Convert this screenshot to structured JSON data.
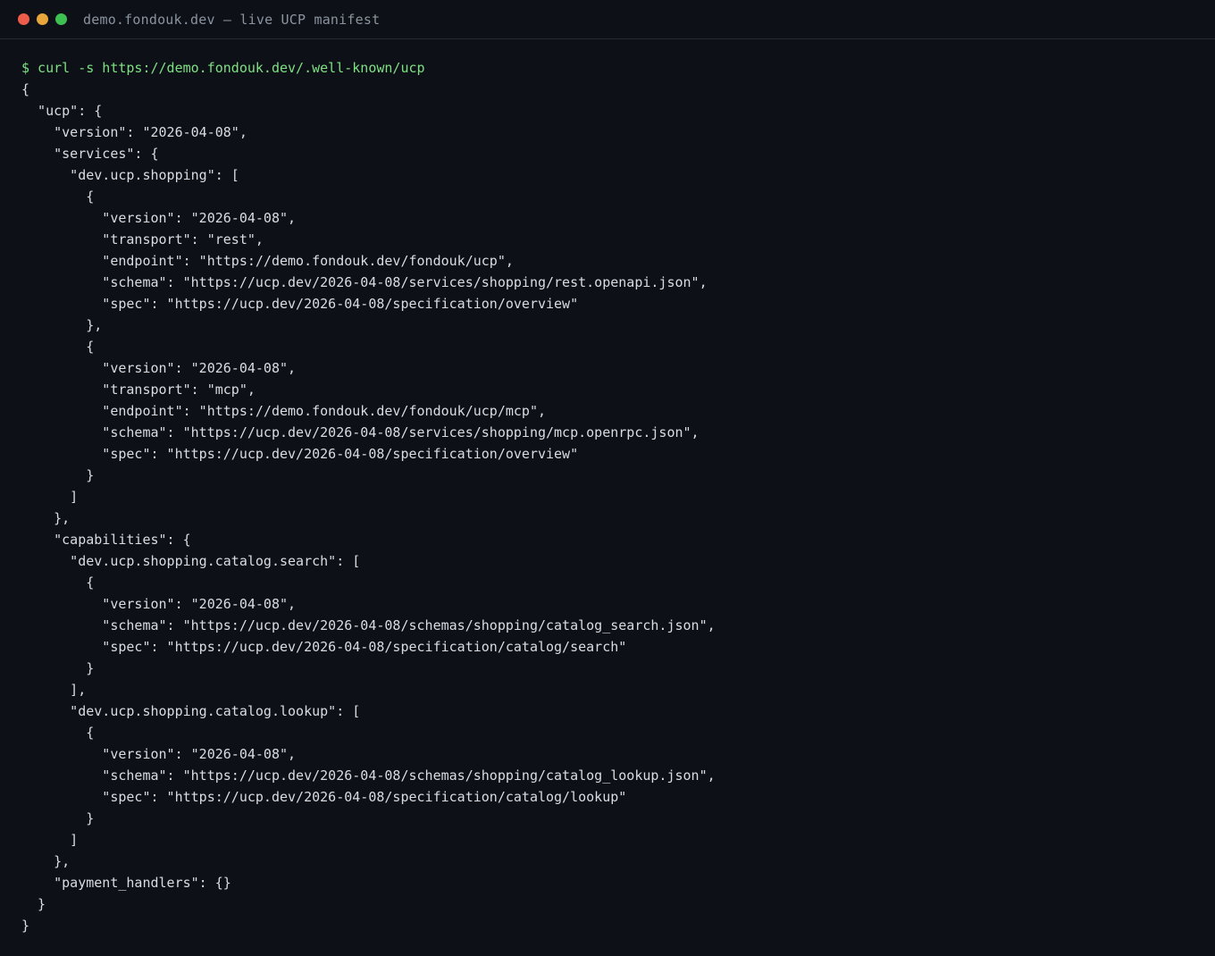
{
  "window": {
    "title": "demo.fondouk.dev — live UCP manifest",
    "controls": {
      "close_color": "#ee5c4b",
      "minimize_color": "#e7a53c",
      "maximize_color": "#3dbf52"
    }
  },
  "terminal": {
    "command": "$ curl -s https://demo.fondouk.dev/.well-known/ucp",
    "output": "{\n  \"ucp\": {\n    \"version\": \"2026-04-08\",\n    \"services\": {\n      \"dev.ucp.shopping\": [\n        {\n          \"version\": \"2026-04-08\",\n          \"transport\": \"rest\",\n          \"endpoint\": \"https://demo.fondouk.dev/fondouk/ucp\",\n          \"schema\": \"https://ucp.dev/2026-04-08/services/shopping/rest.openapi.json\",\n          \"spec\": \"https://ucp.dev/2026-04-08/specification/overview\"\n        },\n        {\n          \"version\": \"2026-04-08\",\n          \"transport\": \"mcp\",\n          \"endpoint\": \"https://demo.fondouk.dev/fondouk/ucp/mcp\",\n          \"schema\": \"https://ucp.dev/2026-04-08/services/shopping/mcp.openrpc.json\",\n          \"spec\": \"https://ucp.dev/2026-04-08/specification/overview\"\n        }\n      ]\n    },\n    \"capabilities\": {\n      \"dev.ucp.shopping.catalog.search\": [\n        {\n          \"version\": \"2026-04-08\",\n          \"schema\": \"https://ucp.dev/2026-04-08/schemas/shopping/catalog_search.json\",\n          \"spec\": \"https://ucp.dev/2026-04-08/specification/catalog/search\"\n        }\n      ],\n      \"dev.ucp.shopping.catalog.lookup\": [\n        {\n          \"version\": \"2026-04-08\",\n          \"schema\": \"https://ucp.dev/2026-04-08/schemas/shopping/catalog_lookup.json\",\n          \"spec\": \"https://ucp.dev/2026-04-08/specification/catalog/lookup\"\n        }\n      ]\n    },\n    \"payment_handlers\": {}\n  }\n}",
    "prompt_color": "#7ee083",
    "text_color": "#d9dde3",
    "background_color": "#0d1117"
  }
}
